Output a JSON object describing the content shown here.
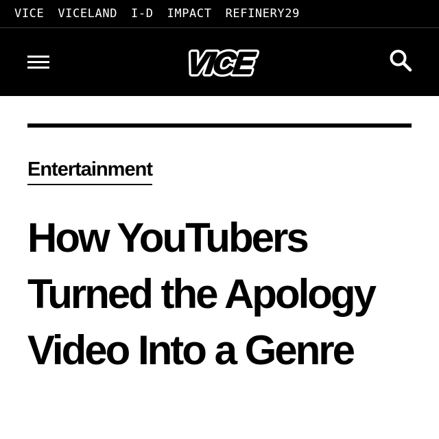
{
  "network_nav": {
    "items": [
      {
        "label": "VICE"
      },
      {
        "label": "VICELAND"
      },
      {
        "label": "I-D"
      },
      {
        "label": "IMPACT"
      },
      {
        "label": "REFINERY29"
      }
    ]
  },
  "header": {
    "menu_icon": "hamburger-icon",
    "logo_text": "VICE",
    "search_icon": "search-icon"
  },
  "article": {
    "section": "Entertainment",
    "headline": "How YouTubers Turned the Apology Video Into a Genre"
  },
  "colors": {
    "header_background": "#000000",
    "page_background": "#ffffff",
    "text": "#000000"
  }
}
